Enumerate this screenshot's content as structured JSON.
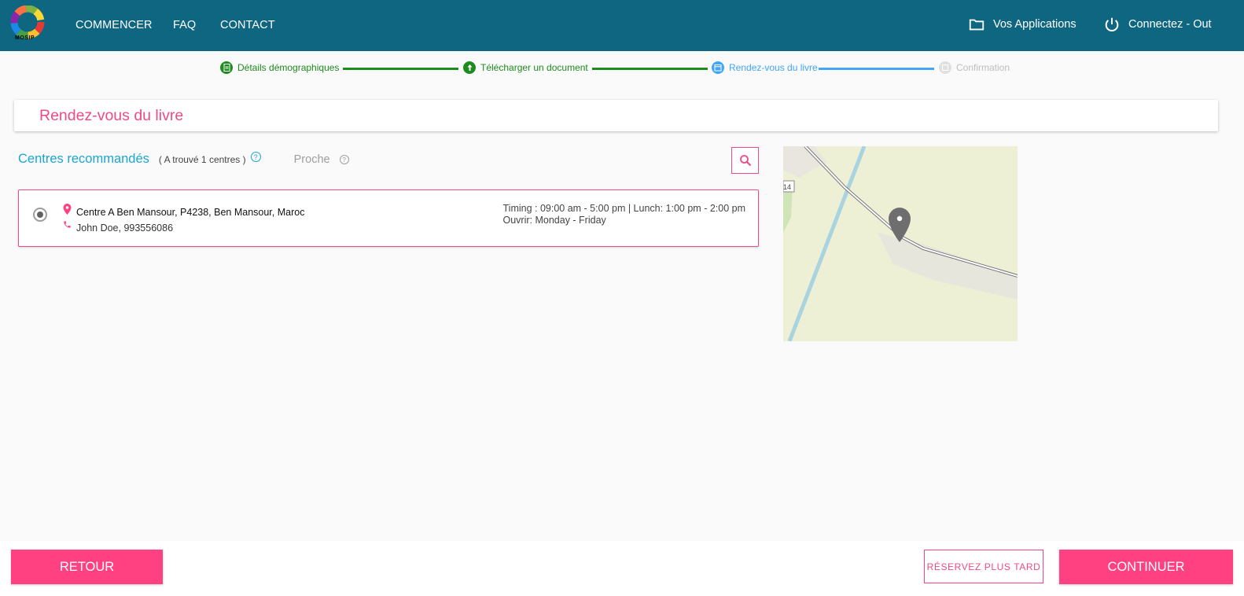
{
  "header": {
    "logo_label": "MOSIP",
    "nav": [
      {
        "label": "COMMENCER"
      },
      {
        "label": "FAQ"
      },
      {
        "label": "CONTACT"
      }
    ],
    "applications_label": "Vos Applications",
    "logout_label": "Connectez - Out"
  },
  "stepper": {
    "steps": [
      {
        "label": "Détails démographiques",
        "state": "done",
        "icon": "document-icon"
      },
      {
        "label": "Télécharger un document",
        "state": "done",
        "icon": "upload-icon"
      },
      {
        "label": "Rendez-vous du livre",
        "state": "active",
        "icon": "calendar-icon"
      },
      {
        "label": "Confirmation",
        "state": "pending",
        "icon": "check-icon"
      }
    ]
  },
  "page": {
    "title": "Rendez-vous du livre"
  },
  "centres": {
    "title": "Centres recommandés",
    "count_text": "( A trouvé 1 centres )",
    "nearby_label": "Proche",
    "help_glyph": "?",
    "items": [
      {
        "address": "Centre A Ben Mansour, P4238, Ben Mansour, Maroc",
        "contact": "John Doe, 993556086",
        "timing": "Timing : 09:00 am - 5:00 pm | Lunch: 1:00 pm - 2:00 pm",
        "open": "Ouvrir: Monday - Friday",
        "selected": true
      }
    ]
  },
  "map": {
    "road_label": "14"
  },
  "footer": {
    "back_label": "RETOUR",
    "later_label": "RÉSERVEZ PLUS TARD",
    "continue_label": "CONTINUER"
  },
  "colors": {
    "header_bg": "#0e6680",
    "accent_pink": "#ff4081",
    "step_done": "#1e8b1e",
    "step_active": "#42a5f5",
    "step_pending": "#bdbdbd",
    "centres_title": "#1aa6d1"
  }
}
